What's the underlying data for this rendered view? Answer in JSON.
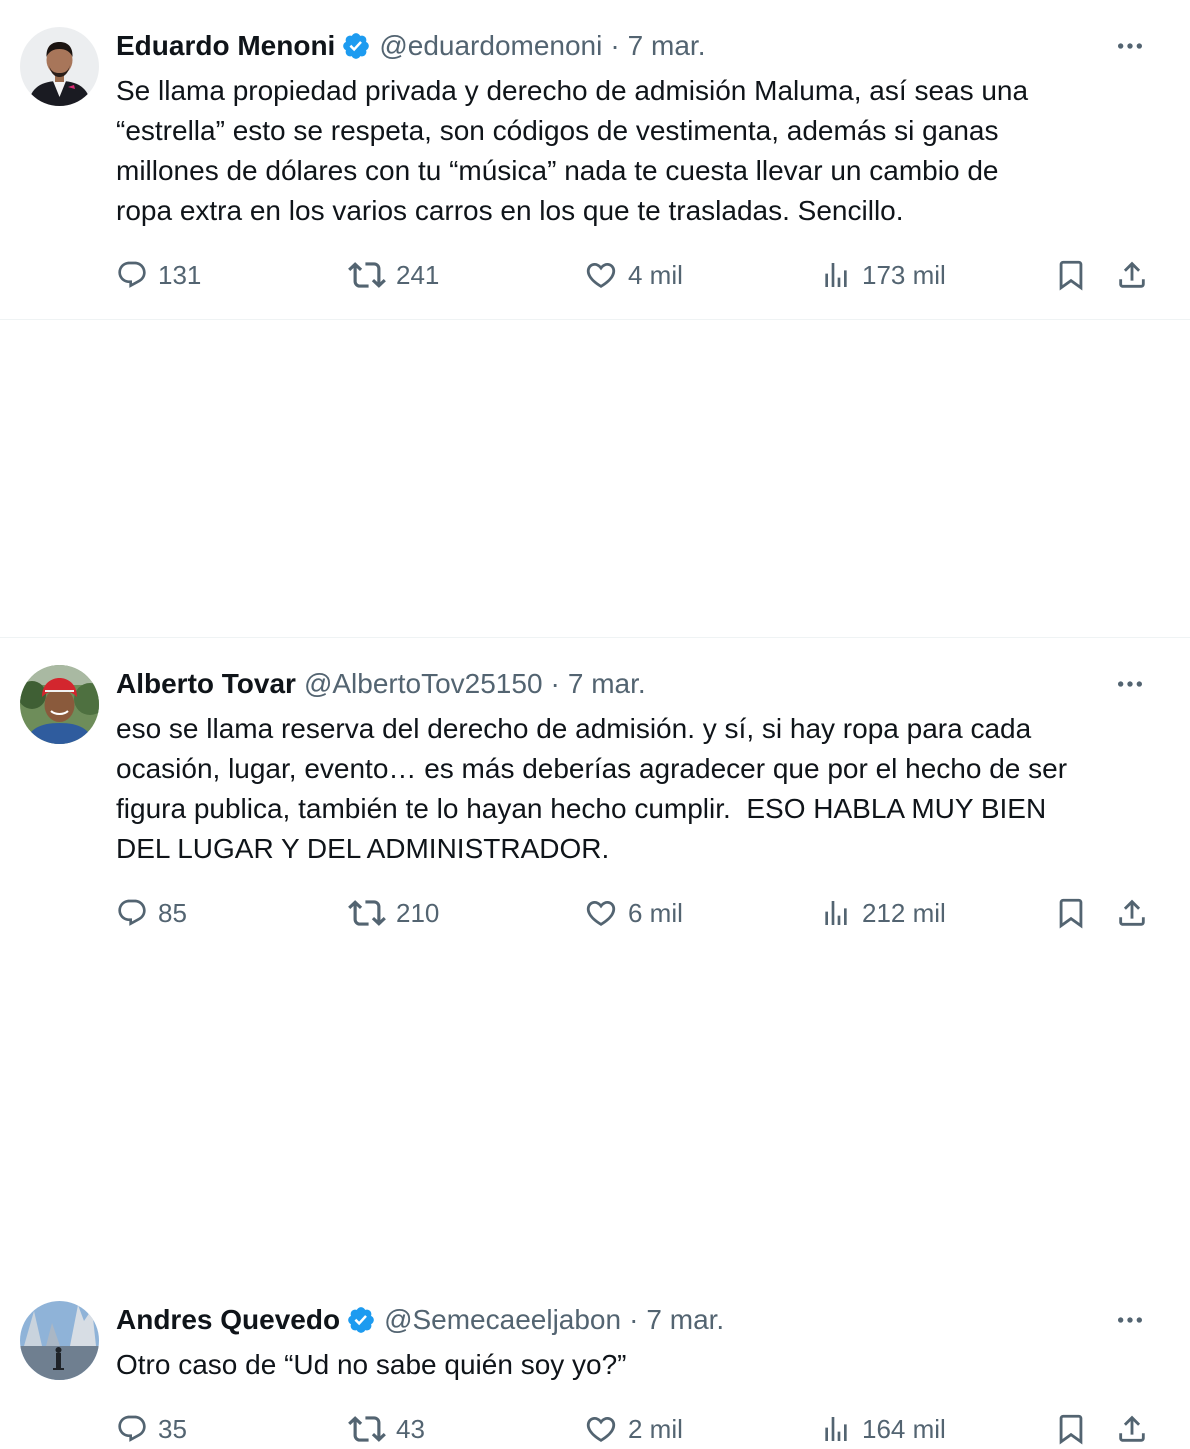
{
  "colors": {
    "text": "#0f1419",
    "secondary": "#536471",
    "verified": "#1d9bf0",
    "divider": "#eff3f4"
  },
  "icons": [
    "verified-badge-icon",
    "more-options-icon",
    "reply-icon",
    "retweet-icon",
    "like-icon",
    "views-icon",
    "bookmark-icon",
    "share-icon"
  ],
  "tweets": [
    {
      "name": "Eduardo Menoni",
      "verified": true,
      "handle": "@eduardomenoni",
      "separator": "·",
      "date": "7 mar.",
      "text": "Se llama propiedad privada y derecho de admisión Maluma, así seas una\n“estrella” esto se respeta, son códigos de vestimenta, además si ganas\nmillones de dólares con tu “música” nada te cuesta llevar un cambio de\nropa extra en los varios carros en los que te trasladas. Sencillo.",
      "replies": "131",
      "retweets": "241",
      "likes": "4 mil",
      "views": "173 mil"
    },
    {
      "name": "Alberto Tovar",
      "verified": false,
      "handle": "@AlbertoTov25150",
      "separator": "·",
      "date": "7 mar.",
      "text": "eso se llama reserva del derecho de admisión. y sí, si hay ropa para cada\nocasión, lugar, evento… es más deberías agradecer que por el hecho de ser\nfigura publica, también te lo hayan hecho cumplir.  ESO HABLA MUY BIEN\nDEL LUGAR Y DEL ADMINISTRADOR.",
      "replies": "85",
      "retweets": "210",
      "likes": "6 mil",
      "views": "212 mil"
    },
    {
      "name": "Andres Quevedo",
      "verified": true,
      "handle": "@Semecaeeljabon",
      "separator": "·",
      "date": "7 mar.",
      "text": "Otro caso de “Ud no sabe quién soy yo?”",
      "replies": "35",
      "retweets": "43",
      "likes": "2 mil",
      "views": "164 mil"
    }
  ]
}
